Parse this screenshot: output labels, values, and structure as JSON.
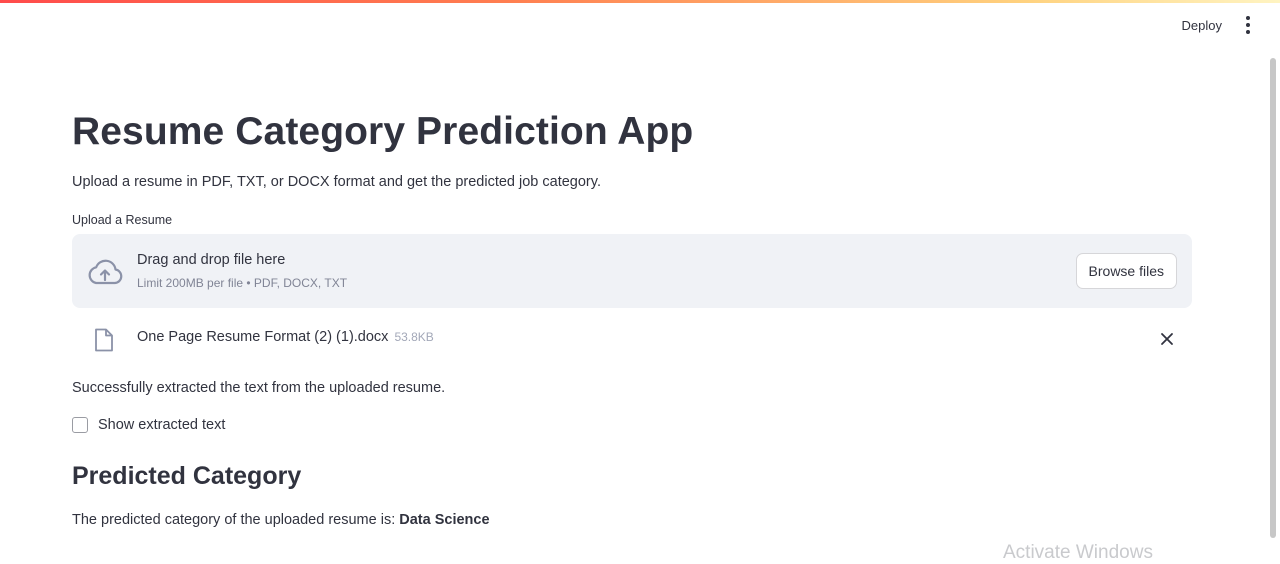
{
  "header": {
    "deploy_label": "Deploy"
  },
  "main": {
    "title": "Resume Category Prediction App",
    "description": "Upload a resume in PDF, TXT, or DOCX format and get the predicted job category.",
    "uploader": {
      "label": "Upload a Resume",
      "drop_text": "Drag and drop file here",
      "limit_text": "Limit 200MB per file • PDF, DOCX, TXT",
      "browse_label": "Browse files"
    },
    "file": {
      "name": "One Page Resume Format (2) (1).docx",
      "size": "53.8KB"
    },
    "success_text": "Successfully extracted the text from the uploaded resume.",
    "checkbox": {
      "label": "Show extracted text",
      "checked": false
    },
    "prediction": {
      "heading": "Predicted Category",
      "text": "The predicted category of the uploaded resume is:",
      "category": "Data Science"
    }
  },
  "watermark": "Activate Windows",
  "colors": {
    "text": "#31333f",
    "dropzone_bg": "#f0f2f6",
    "muted": "#808495",
    "accent": "#ff4b4b"
  },
  "icons": [
    "cloud-upload-icon",
    "file-icon",
    "close-icon",
    "more-vert-icon"
  ]
}
